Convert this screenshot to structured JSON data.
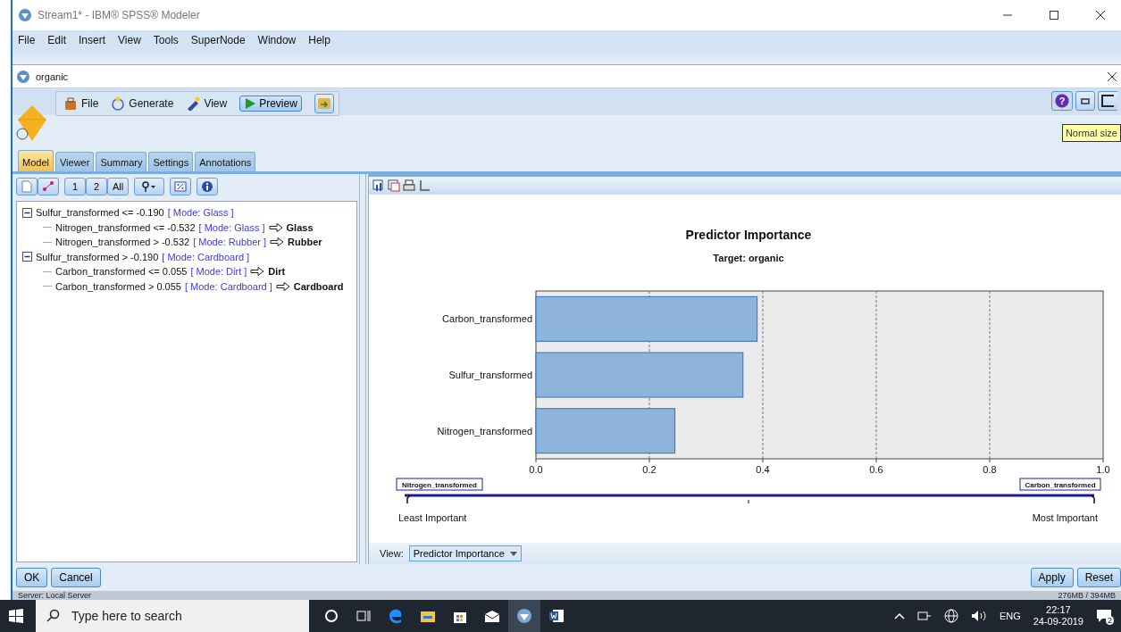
{
  "window": {
    "title": "Stream1* - IBM® SPSS® Modeler"
  },
  "menu": [
    "File",
    "Edit",
    "Insert",
    "View",
    "Tools",
    "SuperNode",
    "Window",
    "Help"
  ],
  "dialog": {
    "title": "organic",
    "toolbar": [
      {
        "label": "File",
        "kind": "menu"
      },
      {
        "label": "Generate",
        "kind": "menu"
      },
      {
        "label": "View",
        "kind": "menu"
      },
      {
        "label": "Preview",
        "kind": "button"
      }
    ],
    "help_button": "?",
    "tooltip": "Normal size",
    "tabs": [
      {
        "label": "Model",
        "selected": true
      },
      {
        "label": "Viewer",
        "selected": false
      },
      {
        "label": "Summary",
        "selected": false
      },
      {
        "label": "Settings",
        "selected": false
      },
      {
        "label": "Annotations",
        "selected": false
      }
    ],
    "tree_toolbar": [
      "1",
      "2",
      "All"
    ],
    "tree": [
      {
        "condition": "Sulfur_transformed <= -0.190",
        "mode": "[ Mode: Glass ]",
        "expanded": true,
        "children": [
          {
            "condition": "Nitrogen_transformed <= -0.532",
            "mode": "[ Mode: Glass ]",
            "result": "Glass"
          },
          {
            "condition": "Nitrogen_transformed > -0.532",
            "mode": "[ Mode: Rubber ]",
            "result": "Rubber"
          }
        ]
      },
      {
        "condition": "Sulfur_transformed > -0.190",
        "mode": "[ Mode: Cardboard ]",
        "expanded": true,
        "children": [
          {
            "condition": "Carbon_transformed <= 0.055",
            "mode": "[ Mode: Dirt ]",
            "result": "Dirt"
          },
          {
            "condition": "Carbon_transformed > 0.055",
            "mode": "[ Mode: Cardboard ]",
            "result": "Cardboard"
          }
        ]
      }
    ],
    "chart_subtitle": "Target: organic",
    "chart_data": {
      "type": "bar",
      "orientation": "horizontal",
      "title": "Predictor Importance",
      "categories": [
        "Carbon_transformed",
        "Sulfur_transformed",
        "Nitrogen_transformed"
      ],
      "values": [
        0.39,
        0.365,
        0.245
      ],
      "xlim": [
        0,
        1
      ],
      "grid": true,
      "xticks": [
        {
          "value": 0,
          "label": "0.0"
        },
        {
          "value": 0.2,
          "label": "0.2"
        },
        {
          "value": 0.4,
          "label": "0.4"
        },
        {
          "value": 0.6,
          "label": "0.6"
        },
        {
          "value": 0.8,
          "label": "0.8"
        },
        {
          "value": 1,
          "label": "1.0"
        }
      ]
    },
    "importance_scale": {
      "least_label": "Nitrogen_transformed",
      "most_label": "Carbon_transformed",
      "low_text": "Least Important",
      "high_text": "Most Important"
    },
    "view_label": "View:",
    "view_value": "Predictor Importance",
    "buttons_left": [
      "OK",
      "Cancel"
    ],
    "buttons_right": [
      "Apply",
      "Reset"
    ]
  },
  "status_bar": {
    "server": "Server: Local Server",
    "memory": "276MB / 394MB"
  },
  "taskbar": {
    "search_placeholder": "Type here to search",
    "language": "ENG",
    "time": "22:17",
    "date": "24-09-2019",
    "notifications": "2"
  }
}
